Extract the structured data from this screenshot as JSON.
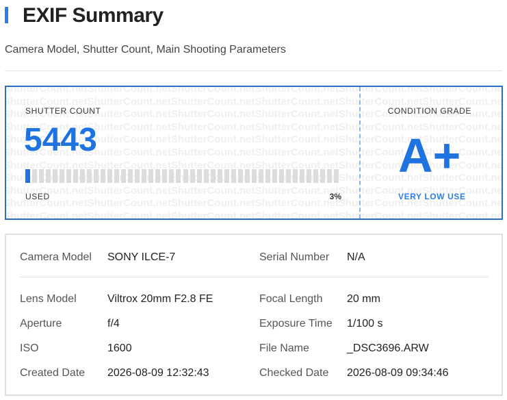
{
  "header": {
    "title": "EXIF Summary",
    "subtitle": "Camera Model, Shutter Count, Main Shooting Parameters"
  },
  "shutter_card": {
    "watermark_text": "ShutterCount.net",
    "shutter_count_label": "SHUTTER COUNT",
    "shutter_count_value": "5443",
    "used_label": "USED",
    "used_percent_label": "3%",
    "used_fraction": 0.03,
    "condition_grade_label": "CONDITION GRADE",
    "condition_grade_value": "A+",
    "condition_grade_desc": "VERY LOW USE"
  },
  "exif": {
    "camera_model_label": "Camera Model",
    "camera_model_value": "SONY ILCE-7",
    "serial_number_label": "Serial Number",
    "serial_number_value": "N/A",
    "lens_model_label": "Lens Model",
    "lens_model_value": "Viltrox 20mm F2.8 FE",
    "focal_length_label": "Focal Length",
    "focal_length_value": "20 mm",
    "aperture_label": "Aperture",
    "aperture_value": "f/4",
    "exposure_time_label": "Exposure Time",
    "exposure_time_value": "1/100 s",
    "iso_label": "ISO",
    "iso_value": "1600",
    "file_name_label": "File Name",
    "file_name_value": "_DSC3696.ARW",
    "created_date_label": "Created Date",
    "created_date_value": "2026-08-09 12:32:43",
    "checked_date_label": "Checked Date",
    "checked_date_value": "2026-08-09 09:34:46"
  },
  "colors": {
    "accent": "#1f73e0",
    "card_border": "#2b6fc2",
    "bar_empty": "#dcdcdc"
  }
}
